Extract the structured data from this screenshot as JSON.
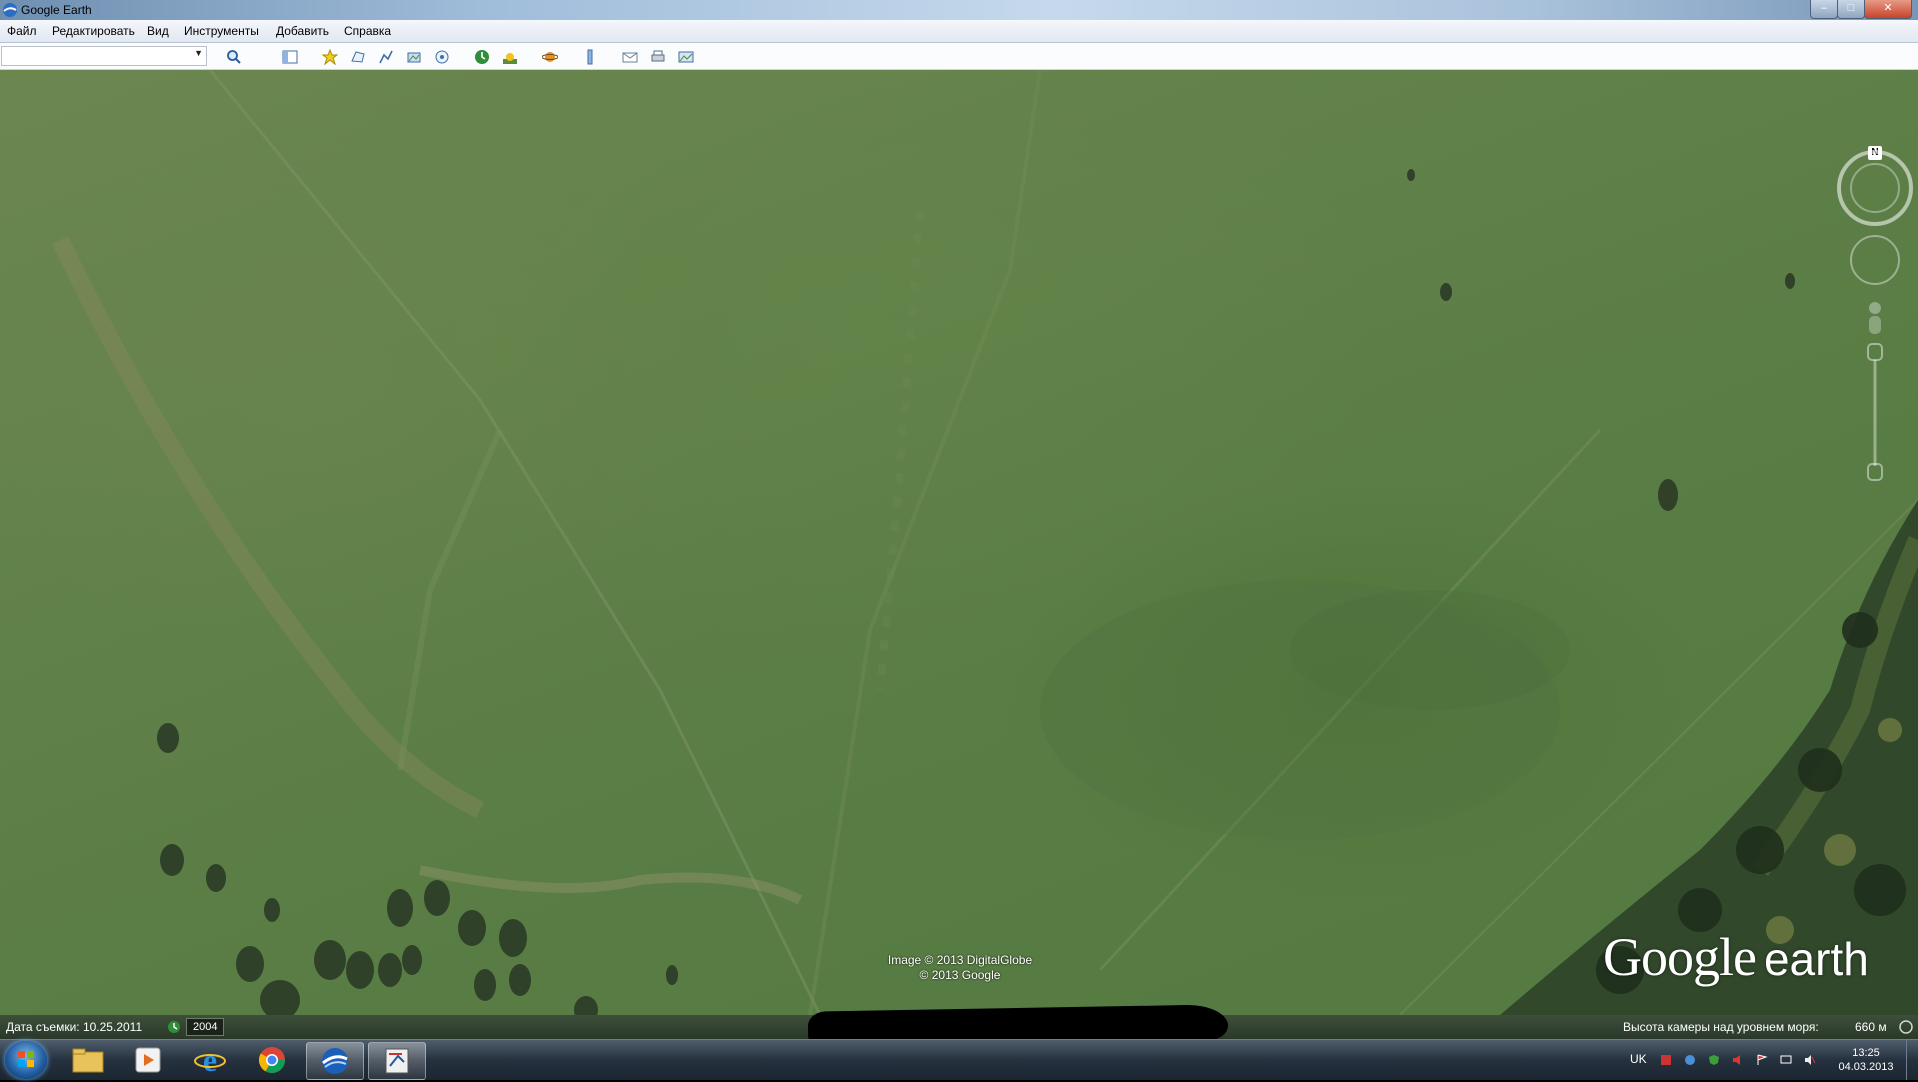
{
  "window": {
    "title": "Google Earth",
    "controls": {
      "minimize": "–",
      "maximize": "□",
      "close": "✕"
    }
  },
  "menu": {
    "items": [
      "Файл",
      "Редактировать",
      "Вид",
      "Инструменты",
      "Добавить",
      "Справка"
    ]
  },
  "toolbar": {
    "search_value": "",
    "buttons": [
      "search-icon",
      "sidebar-icon",
      "placemark-icon",
      "polygon-icon",
      "path-icon",
      "overlay-icon",
      "tour-icon",
      "historical-imagery-icon",
      "sunlight-icon",
      "planets-icon",
      "ruler-icon",
      "email-icon",
      "print-icon",
      "save-image-icon"
    ]
  },
  "map": {
    "attribution_line1": "Image © 2013 DigitalGlobe",
    "attribution_line2": "© 2013 Google",
    "logo_google": "Google",
    "logo_earth": "earth",
    "compass_label": "N"
  },
  "status": {
    "date": "Дата съемки: 10.25.2011",
    "year": "2004",
    "altitude_label": "Высота камеры над уровнем моря:",
    "altitude_value": "660 м"
  },
  "taskbar": {
    "apps": [
      "explorer-icon",
      "media-player-icon",
      "internet-explorer-icon",
      "chrome-icon",
      "google-earth-icon",
      "screenshot-tool-icon"
    ],
    "language": "UK",
    "time": "13:25",
    "date": "04.03.2013"
  },
  "colors": {
    "field_green": "#5e7f47",
    "status_bg": "#2f3d2e",
    "taskbar_bg": "#25313e"
  }
}
